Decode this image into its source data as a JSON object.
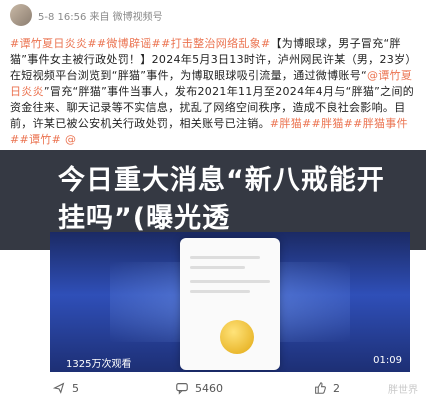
{
  "header": {
    "meta": "5-8 16:56 来自 微博视频号"
  },
  "post": {
    "text_1": "#谭竹夏日炎炎##微博辟谣##打击整治网络乱象#",
    "text_2": "【为博眼球，男子冒充“胖猫”事件女主被行政处罚！】2024年5月3日13时许，泸州网民许某（男，23岁）在短视频平台浏览到“胖猫”事件，为博取眼球吸引流量，通过微博账号“",
    "mention": "@谭竹夏日炎炎",
    "text_3": "”冒充“胖猫”事件当事人，发布2021年11月至2024年4月与“胖猫”之间的资金往来、聊天记录等不实信息，扰乱了网络空间秩序，造成不良社会影响。目前，许某已被公安机关行政处罚，相关账号已注销。",
    "tags_end": "#胖猫##胖猫##胖猫事件##谭竹# @",
    "line_last": "泸州警方 @微博辟谣 @平安泸州 @广州网警 @泸州网警 收起"
  },
  "banner": {
    "headline": "今日重大消息“新八戒能开挂吗”(曝光透"
  },
  "video": {
    "views": "1325万次观看",
    "duration": "01:09"
  },
  "footer": {
    "share": "5",
    "comments": "5460",
    "likes": "2"
  },
  "watermark": "胖世界"
}
